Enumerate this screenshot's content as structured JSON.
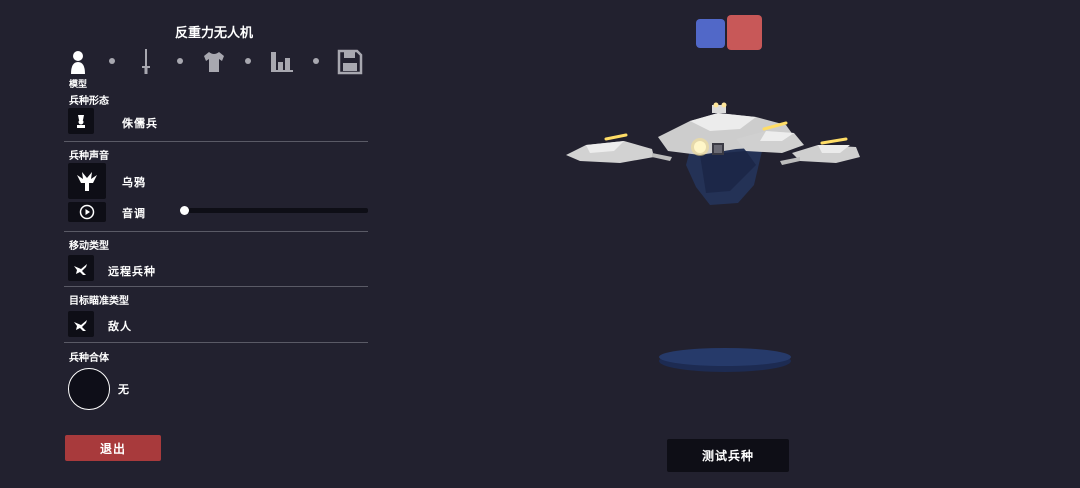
{
  "title": "反重力无人机",
  "tabs": {
    "active_label": "模型",
    "items": [
      "model-tab",
      "weapon-tab",
      "clothing-tab",
      "stats-tab",
      "save-tab"
    ]
  },
  "sections": {
    "form": {
      "label": "兵种形态",
      "value": "侏儒兵"
    },
    "voice": {
      "label": "兵种声音",
      "value": "乌鸦",
      "pitch_label": "音调",
      "pitch_level": 0.0
    },
    "movement": {
      "label": "移动类型",
      "value": "远程兵种"
    },
    "targeting": {
      "label": "目标瞄准类型",
      "value": "敌人"
    },
    "merge": {
      "label": "兵种合体",
      "value": "无"
    }
  },
  "buttons": {
    "exit": "退出",
    "test": "测试兵种"
  },
  "team_colors": {
    "blue": "#5168c8",
    "red": "#c85858"
  },
  "theme": {
    "background": "#22212f",
    "exit": "#a83a3c"
  }
}
